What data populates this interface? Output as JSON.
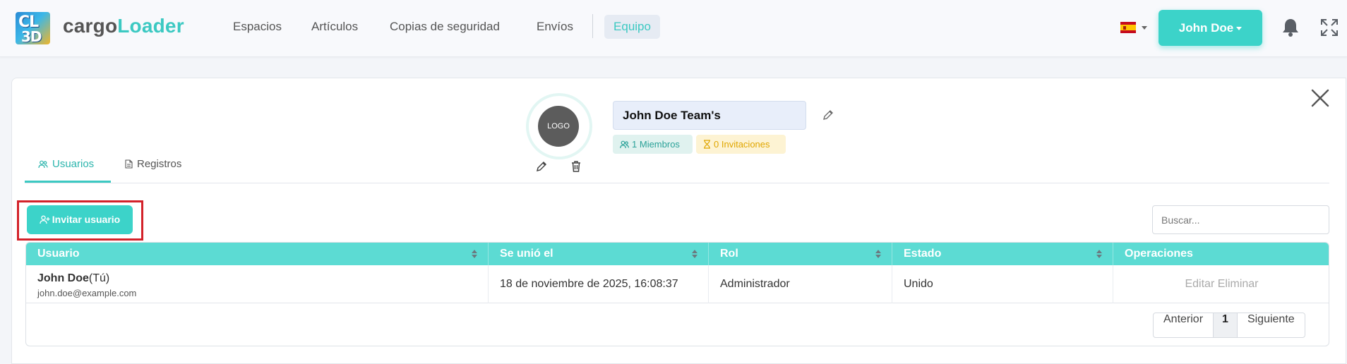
{
  "brand": {
    "logo_line1": "CL",
    "logo_line2": "3D",
    "name_part1": "cargo",
    "name_part2": "Loader"
  },
  "nav": {
    "items": [
      "Espacios",
      "Artículos",
      "Copias de seguridad",
      "Envíos"
    ],
    "active": "Equipo"
  },
  "header": {
    "language_flag": "es",
    "user_label": "John Doe"
  },
  "team": {
    "logo_label": "LOGO",
    "name": "John Doe Team's",
    "members_count": "1",
    "members_label": "Miembros",
    "invitations_count": "0",
    "invitations_label": "Invitaciones"
  },
  "tabs": [
    {
      "label": "Usuarios",
      "active": true
    },
    {
      "label": "Registros",
      "active": false
    }
  ],
  "toolbar": {
    "invite_label": "Invitar usuario",
    "search_placeholder": "Buscar..."
  },
  "table": {
    "columns": [
      "Usuario",
      "Se unió el",
      "Rol",
      "Estado",
      "Operaciones"
    ],
    "rows": [
      {
        "name": "John Doe",
        "you": "(Tú)",
        "email": "john.doe@example.com",
        "joined": "18 de noviembre de 2025, 16:08:37",
        "role": "Administrador",
        "status": "Unido",
        "op_edit": "Editar",
        "op_delete": "Eliminar"
      }
    ]
  },
  "pagination": {
    "prev": "Anterior",
    "current": "1",
    "next": "Siguiente"
  },
  "colors": {
    "accent": "#3cd3c9",
    "table_header": "#5cdbd3",
    "highlight": "#d3222a"
  }
}
